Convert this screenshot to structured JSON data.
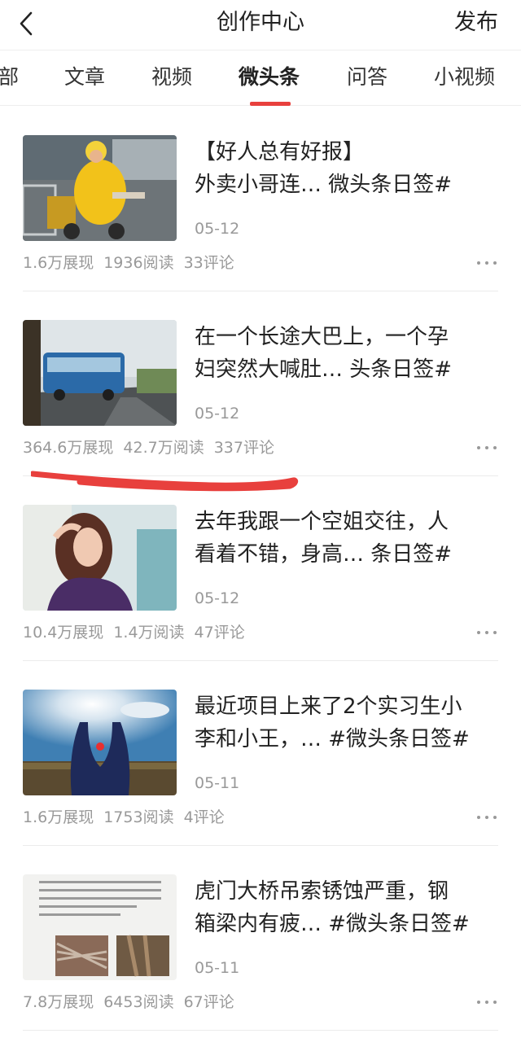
{
  "header": {
    "back_icon": "chevron-left-icon",
    "title": "创作中心",
    "publish_label": "发布"
  },
  "tabs": [
    {
      "label": "部",
      "active": false
    },
    {
      "label": "文章",
      "active": false
    },
    {
      "label": "视频",
      "active": false
    },
    {
      "label": "微头条",
      "active": true
    },
    {
      "label": "问答",
      "active": false
    },
    {
      "label": "小视频",
      "active": false
    }
  ],
  "accent_color": "#e8403d",
  "posts": [
    {
      "title_line1": "【好人总有好报】",
      "title_line2": "外卖小哥连… 微头条日签#",
      "date": "05-12",
      "impressions": "1.6万展现",
      "reads": "1936阅读",
      "comments": "33评论",
      "thumb": "delivery-rider-in-yellow-raincoat"
    },
    {
      "title_line1": "在一个长途大巴上，一个孕",
      "title_line2": "妇突然大喊肚… 头条日签#",
      "date": "05-12",
      "impressions": "364.6万展现",
      "reads": "42.7万阅读",
      "comments": "337评论",
      "thumb": "blue-bus-on-road"
    },
    {
      "title_line1": "去年我跟一个空姐交往，人",
      "title_line2": "看着不错，身高… 条日签#",
      "date": "05-12",
      "impressions": "10.4万展现",
      "reads": "1.4万阅读",
      "comments": "47评论",
      "thumb": "woman-portrait"
    },
    {
      "title_line1": "最近项目上来了2个实习生小",
      "title_line2": "李和小王，… #微头条日签#",
      "date": "05-11",
      "impressions": "1.6万展现",
      "reads": "1753阅读",
      "comments": "4评论",
      "thumb": "hands-holding-sun"
    },
    {
      "title_line1": "虎门大桥吊索锈蚀严重，钢",
      "title_line2": "箱梁内有疲… #微头条日签#",
      "date": "05-11",
      "impressions": "7.8万展现",
      "reads": "6453阅读",
      "comments": "67评论",
      "thumb": "rusted-cable-document"
    }
  ]
}
